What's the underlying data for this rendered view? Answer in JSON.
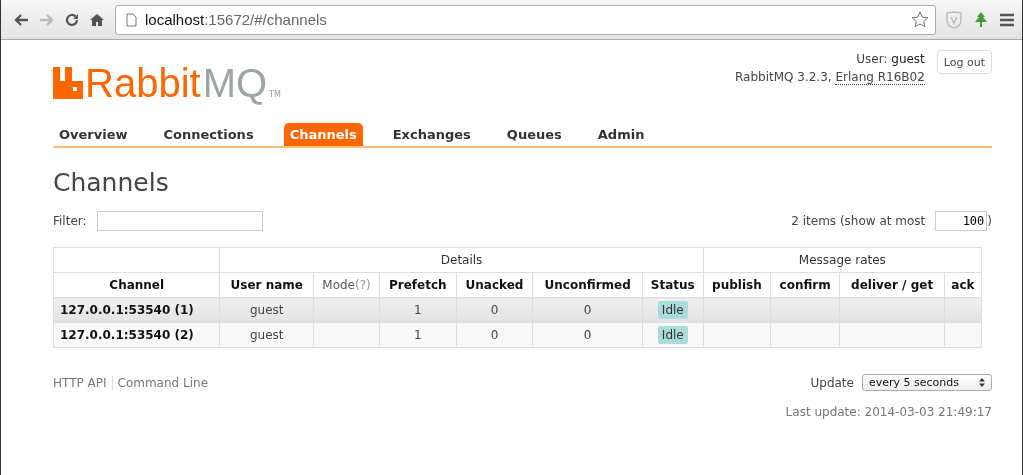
{
  "browser": {
    "url_host": "localhost",
    "url_rest": ":15672/#/channels"
  },
  "logo": {
    "part_1": "Rabbit",
    "part_2": "MQ",
    "mark": "TM"
  },
  "user": {
    "label": "User:",
    "name": "guest",
    "version": "RabbitMQ 3.2.3,",
    "erlang": "Erlang R16B02",
    "logout": "Log out"
  },
  "tabs": [
    {
      "label": "Overview",
      "selected": false
    },
    {
      "label": "Connections",
      "selected": false
    },
    {
      "label": "Channels",
      "selected": true
    },
    {
      "label": "Exchanges",
      "selected": false
    },
    {
      "label": "Queues",
      "selected": false
    },
    {
      "label": "Admin",
      "selected": false
    }
  ],
  "heading": "Channels",
  "filter": {
    "label": "Filter:"
  },
  "paging": {
    "before": "2 items (show at most",
    "value": "100",
    "after": ")"
  },
  "table": {
    "groups": [
      "Details",
      "Message rates"
    ],
    "columns": [
      {
        "label": "Channel"
      },
      {
        "label": "User name"
      },
      {
        "label": "Mode",
        "help": "(?)"
      },
      {
        "label": "Prefetch"
      },
      {
        "label": "Unacked"
      },
      {
        "label": "Unconfirmed"
      },
      {
        "label": "Status"
      },
      {
        "label": "publish"
      },
      {
        "label": "confirm"
      },
      {
        "label": "deliver / get"
      },
      {
        "label": "ack"
      }
    ],
    "rows": [
      {
        "channel": "127.0.0.1:53540 (1)",
        "user": "guest",
        "prefetch": "1",
        "unacked": "0",
        "unconfirmed": "0",
        "status": "Idle"
      },
      {
        "channel": "127.0.0.1:53540 (2)",
        "user": "guest",
        "prefetch": "1",
        "unacked": "0",
        "unconfirmed": "0",
        "status": "Idle"
      }
    ]
  },
  "footer_links": [
    "HTTP API",
    "Command Line"
  ],
  "update": {
    "label": "Update",
    "value": "every 5 seconds"
  },
  "last_update": "Last update: 2014-03-03 21:49:17"
}
